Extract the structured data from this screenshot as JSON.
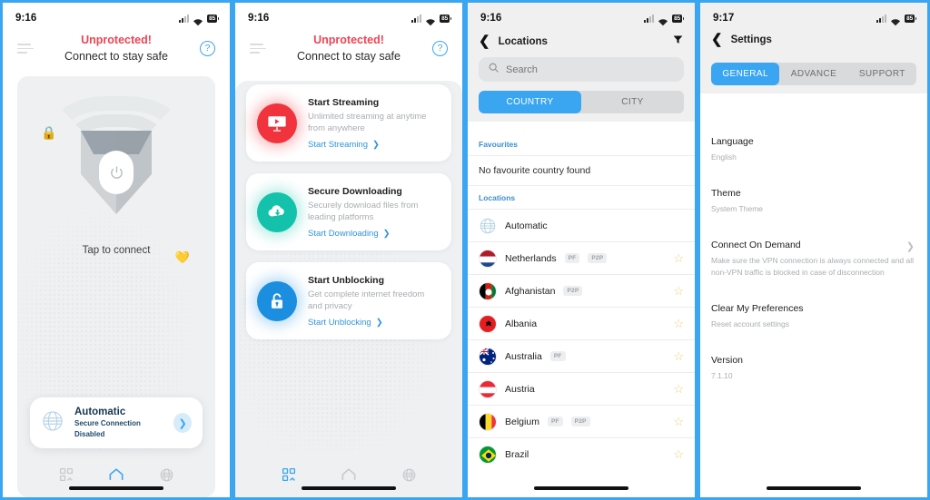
{
  "accent": "#3aa5f0",
  "danger": "#f04352",
  "screens": [
    {
      "id": "home-disconnected",
      "statusbar": {
        "time": "9:16",
        "battery": "85"
      },
      "header": {
        "title": "Unprotected!",
        "subtitle": "Connect to stay safe",
        "menu_icon": "hamburger-icon",
        "help_icon": "help-circle-icon"
      },
      "map": {
        "tap_text": "Tap to connect",
        "shield_icon": "shield-power-icon",
        "lock_icon": "lock-icon",
        "heart_icon": "heart-icon"
      },
      "connection_card": {
        "name": "Automatic",
        "status": "Secure Connection Disabled",
        "globe_icon": "globe-icon",
        "chevron": "❯"
      },
      "bottom_nav": [
        {
          "icon": "apps-grid-icon",
          "active": false
        },
        {
          "icon": "home-icon",
          "active": true
        },
        {
          "icon": "globe-icon",
          "active": false
        }
      ]
    },
    {
      "id": "features",
      "statusbar": {
        "time": "9:16",
        "battery": "85"
      },
      "header": {
        "title": "Unprotected!",
        "subtitle": "Connect to stay safe",
        "menu_icon": "hamburger-icon",
        "help_icon": "help-circle-icon"
      },
      "cards": [
        {
          "icon": "monitor-play-icon",
          "color": "#f0333c",
          "title": "Start Streaming",
          "desc": "Unlimited streaming at anytime from anywhere",
          "link": "Start Streaming",
          "chevron": "❯"
        },
        {
          "icon": "cloud-download-icon",
          "color": "#14c2ab",
          "title": "Secure Downloading",
          "desc": "Securely download files from leading platforms",
          "link": "Start Downloading",
          "chevron": "❯"
        },
        {
          "icon": "lock-open-icon",
          "color": "#1b8ee0",
          "title": "Start Unblocking",
          "desc": "Get complete internet freedom and privacy",
          "link": "Start Unblocking",
          "chevron": "❯"
        }
      ],
      "bottom_nav": [
        {
          "icon": "apps-grid-icon",
          "active": true
        },
        {
          "icon": "home-icon",
          "active": false
        },
        {
          "icon": "globe-icon",
          "active": false
        }
      ]
    },
    {
      "id": "locations",
      "statusbar": {
        "time": "9:16",
        "battery": "85"
      },
      "nav": {
        "back_icon": "chevron-left-icon",
        "title": "Locations",
        "filter_icon": "filter-icon"
      },
      "search": {
        "placeholder": "Search",
        "value": "",
        "icon": "search-icon"
      },
      "segments": [
        {
          "label": "COUNTRY",
          "active": true
        },
        {
          "label": "CITY",
          "active": false
        }
      ],
      "favourites": {
        "label": "Favourites",
        "empty_text": "No favourite country found"
      },
      "locations_label": "Locations",
      "countries": [
        {
          "name": "Automatic",
          "badges": [],
          "flag": "globe",
          "star": false
        },
        {
          "name": "Netherlands",
          "badges": [
            "PF",
            "P2P"
          ],
          "flag": "nl",
          "star": true
        },
        {
          "name": "Afghanistan",
          "badges": [
            "P2P"
          ],
          "flag": "af",
          "star": true
        },
        {
          "name": "Albania",
          "badges": [],
          "flag": "al",
          "star": true
        },
        {
          "name": "Australia",
          "badges": [
            "PF"
          ],
          "flag": "au",
          "star": true
        },
        {
          "name": "Austria",
          "badges": [],
          "flag": "at",
          "star": true
        },
        {
          "name": "Belgium",
          "badges": [
            "PF",
            "P2P"
          ],
          "flag": "be",
          "star": true
        },
        {
          "name": "Brazil",
          "badges": [],
          "flag": "br",
          "star": true
        }
      ],
      "star_glyph": "☆"
    },
    {
      "id": "settings",
      "statusbar": {
        "time": "9:17",
        "battery": "85"
      },
      "nav": {
        "back_icon": "chevron-left-icon",
        "title": "Settings"
      },
      "tabs": [
        {
          "label": "GENERAL",
          "active": true
        },
        {
          "label": "ADVANCE",
          "active": false
        },
        {
          "label": "SUPPORT",
          "active": false
        }
      ],
      "rows": [
        {
          "title": "Language",
          "value": "English",
          "chevron": false
        },
        {
          "title": "Theme",
          "value": "System Theme",
          "chevron": false
        },
        {
          "title": "Connect On Demand",
          "value": "Make sure the VPN connection is always connected and all non-VPN traffic is blocked in case of disconnection",
          "chevron": true
        },
        {
          "title": "Clear My Preferences",
          "value": "Reset account settings",
          "chevron": false
        },
        {
          "title": "Version",
          "value": "7.1.10",
          "chevron": false
        }
      ],
      "chevron_glyph": "❯"
    }
  ]
}
